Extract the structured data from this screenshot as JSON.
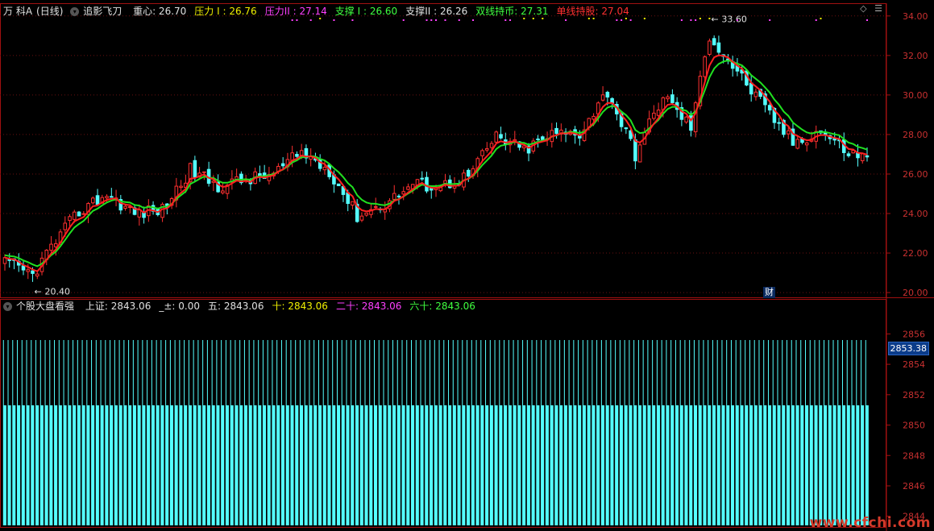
{
  "top_legend": {
    "stock": "万 科A",
    "period": "(日线)",
    "indicator": "追影飞刀",
    "items": [
      {
        "label": "重心: 26.70",
        "color": "#e0e0e0"
      },
      {
        "label": "压力 I : 26.76",
        "color": "#f0f000"
      },
      {
        "label": "压力II : 27.14",
        "color": "#ff40ff"
      },
      {
        "label": "支撑 I : 26.60",
        "color": "#40ff40"
      },
      {
        "label": "支撑II : 26.26",
        "color": "#e0e0e0"
      },
      {
        "label": "双线持币: 27.31",
        "color": "#40ff40"
      },
      {
        "label": "单线持股: 27.04",
        "color": "#ff3030"
      }
    ]
  },
  "bottom_legend": {
    "indicator": "个股大盘看强",
    "items": [
      {
        "label": "上证: 2843.06",
        "color": "#e0e0e0"
      },
      {
        "label": "_±: 0.00",
        "color": "#e0e0e0"
      },
      {
        "label": "五: 2843.06",
        "color": "#e0e0e0"
      },
      {
        "label": "十: 2843.06",
        "color": "#f0f000"
      },
      {
        "label": "二十: 2843.06",
        "color": "#ff40ff"
      },
      {
        "label": "六十: 2843.06",
        "color": "#40ff40"
      }
    ]
  },
  "corner_icons": [
    "diamond-icon",
    "menu-icon"
  ],
  "cai_badge": "财",
  "last_price_label": "2853.38",
  "watermark": "www.cfchi.com",
  "chart_data": [
    {
      "type": "candlestick",
      "ylim": [
        19.8,
        34.4
      ],
      "yticks": [
        "34.00",
        "32.00",
        "30.00",
        "28.00",
        "26.00",
        "24.00",
        "22.00",
        "20.00"
      ],
      "ytick_values": [
        34,
        32,
        30,
        28,
        26,
        24,
        22,
        20
      ],
      "annotations": [
        {
          "text": "20.40",
          "index": 6,
          "value": 20.4
        },
        {
          "text": "33.60",
          "index": 152,
          "value": 33.6
        }
      ],
      "close_anchor_points": [
        [
          0,
          21.5
        ],
        [
          6,
          20.9
        ],
        [
          10,
          22.3
        ],
        [
          16,
          24.1
        ],
        [
          22,
          25.0
        ],
        [
          28,
          24.0
        ],
        [
          34,
          24.2
        ],
        [
          40,
          26.2
        ],
        [
          46,
          25.4
        ],
        [
          52,
          25.7
        ],
        [
          58,
          26.0
        ],
        [
          64,
          27.1
        ],
        [
          70,
          26.2
        ],
        [
          76,
          23.9
        ],
        [
          82,
          24.5
        ],
        [
          88,
          25.5
        ],
        [
          94,
          25.4
        ],
        [
          100,
          25.9
        ],
        [
          106,
          27.9
        ],
        [
          112,
          27.2
        ],
        [
          118,
          28.0
        ],
        [
          124,
          28.1
        ],
        [
          130,
          30.2
        ],
        [
          136,
          27.0
        ],
        [
          142,
          30.0
        ],
        [
          148,
          28.4
        ],
        [
          152,
          33.0
        ],
        [
          158,
          31.2
        ],
        [
          164,
          29.3
        ],
        [
          170,
          27.6
        ],
        [
          176,
          28.2
        ],
        [
          182,
          27.1
        ],
        [
          186,
          26.8
        ]
      ],
      "series_lines": [
        {
          "name": "单线持股",
          "color": "#ff2020"
        },
        {
          "name": "双线持币",
          "color": "#20e020"
        }
      ]
    },
    {
      "type": "bar",
      "ylim": [
        2843.4,
        2857.4
      ],
      "yticks": [
        "2856",
        "2854",
        "2852",
        "2850",
        "2848",
        "2846",
        "2844"
      ],
      "ytick_values": [
        2856,
        2854,
        2852,
        2850,
        2848,
        2846,
        2844
      ],
      "bar_count": 187,
      "outline_top": 2855.6,
      "filled_top": 2851.3
    }
  ]
}
